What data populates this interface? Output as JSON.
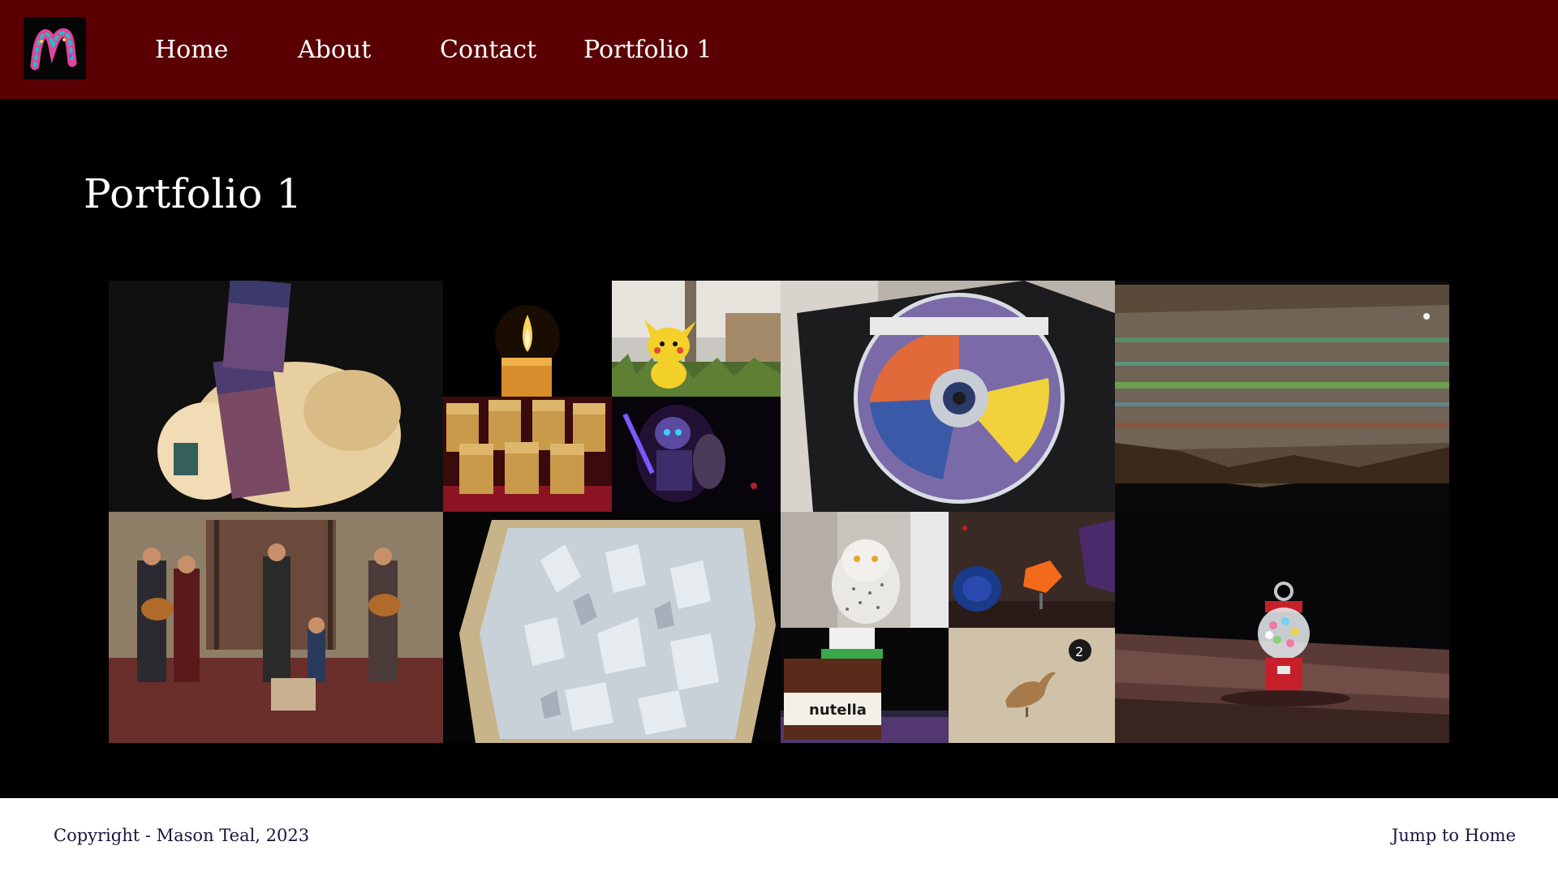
{
  "header": {
    "logo_icon": "m-logo-icon",
    "nav": {
      "home": "Home",
      "about": "About",
      "contact": "Contact",
      "portfolio": "Portfolio 1"
    },
    "colors": {
      "background": "#5a0003",
      "text": "#ffffff"
    }
  },
  "main": {
    "title": "Portfolio 1",
    "gallery": [
      "tourmaline-crystal-photo",
      "candle-photo",
      "pichu-figure-photo",
      "popcorn-cups-photo",
      "robot-figure-photo",
      "xbox-disc-photo",
      "opal-stone-photo",
      "street-band-photo",
      "celestite-geode-photo",
      "snowy-owl-photo",
      "minerals-photo",
      "nutella-jar-photo",
      "bird-artifact-photo",
      "gumball-machine-charm-photo"
    ]
  },
  "footer": {
    "copyright": "Copyright - Mason Teal, 2023",
    "jump_link": "Jump to Home",
    "colors": {
      "background": "#ffffff",
      "text": "#16163f"
    }
  }
}
